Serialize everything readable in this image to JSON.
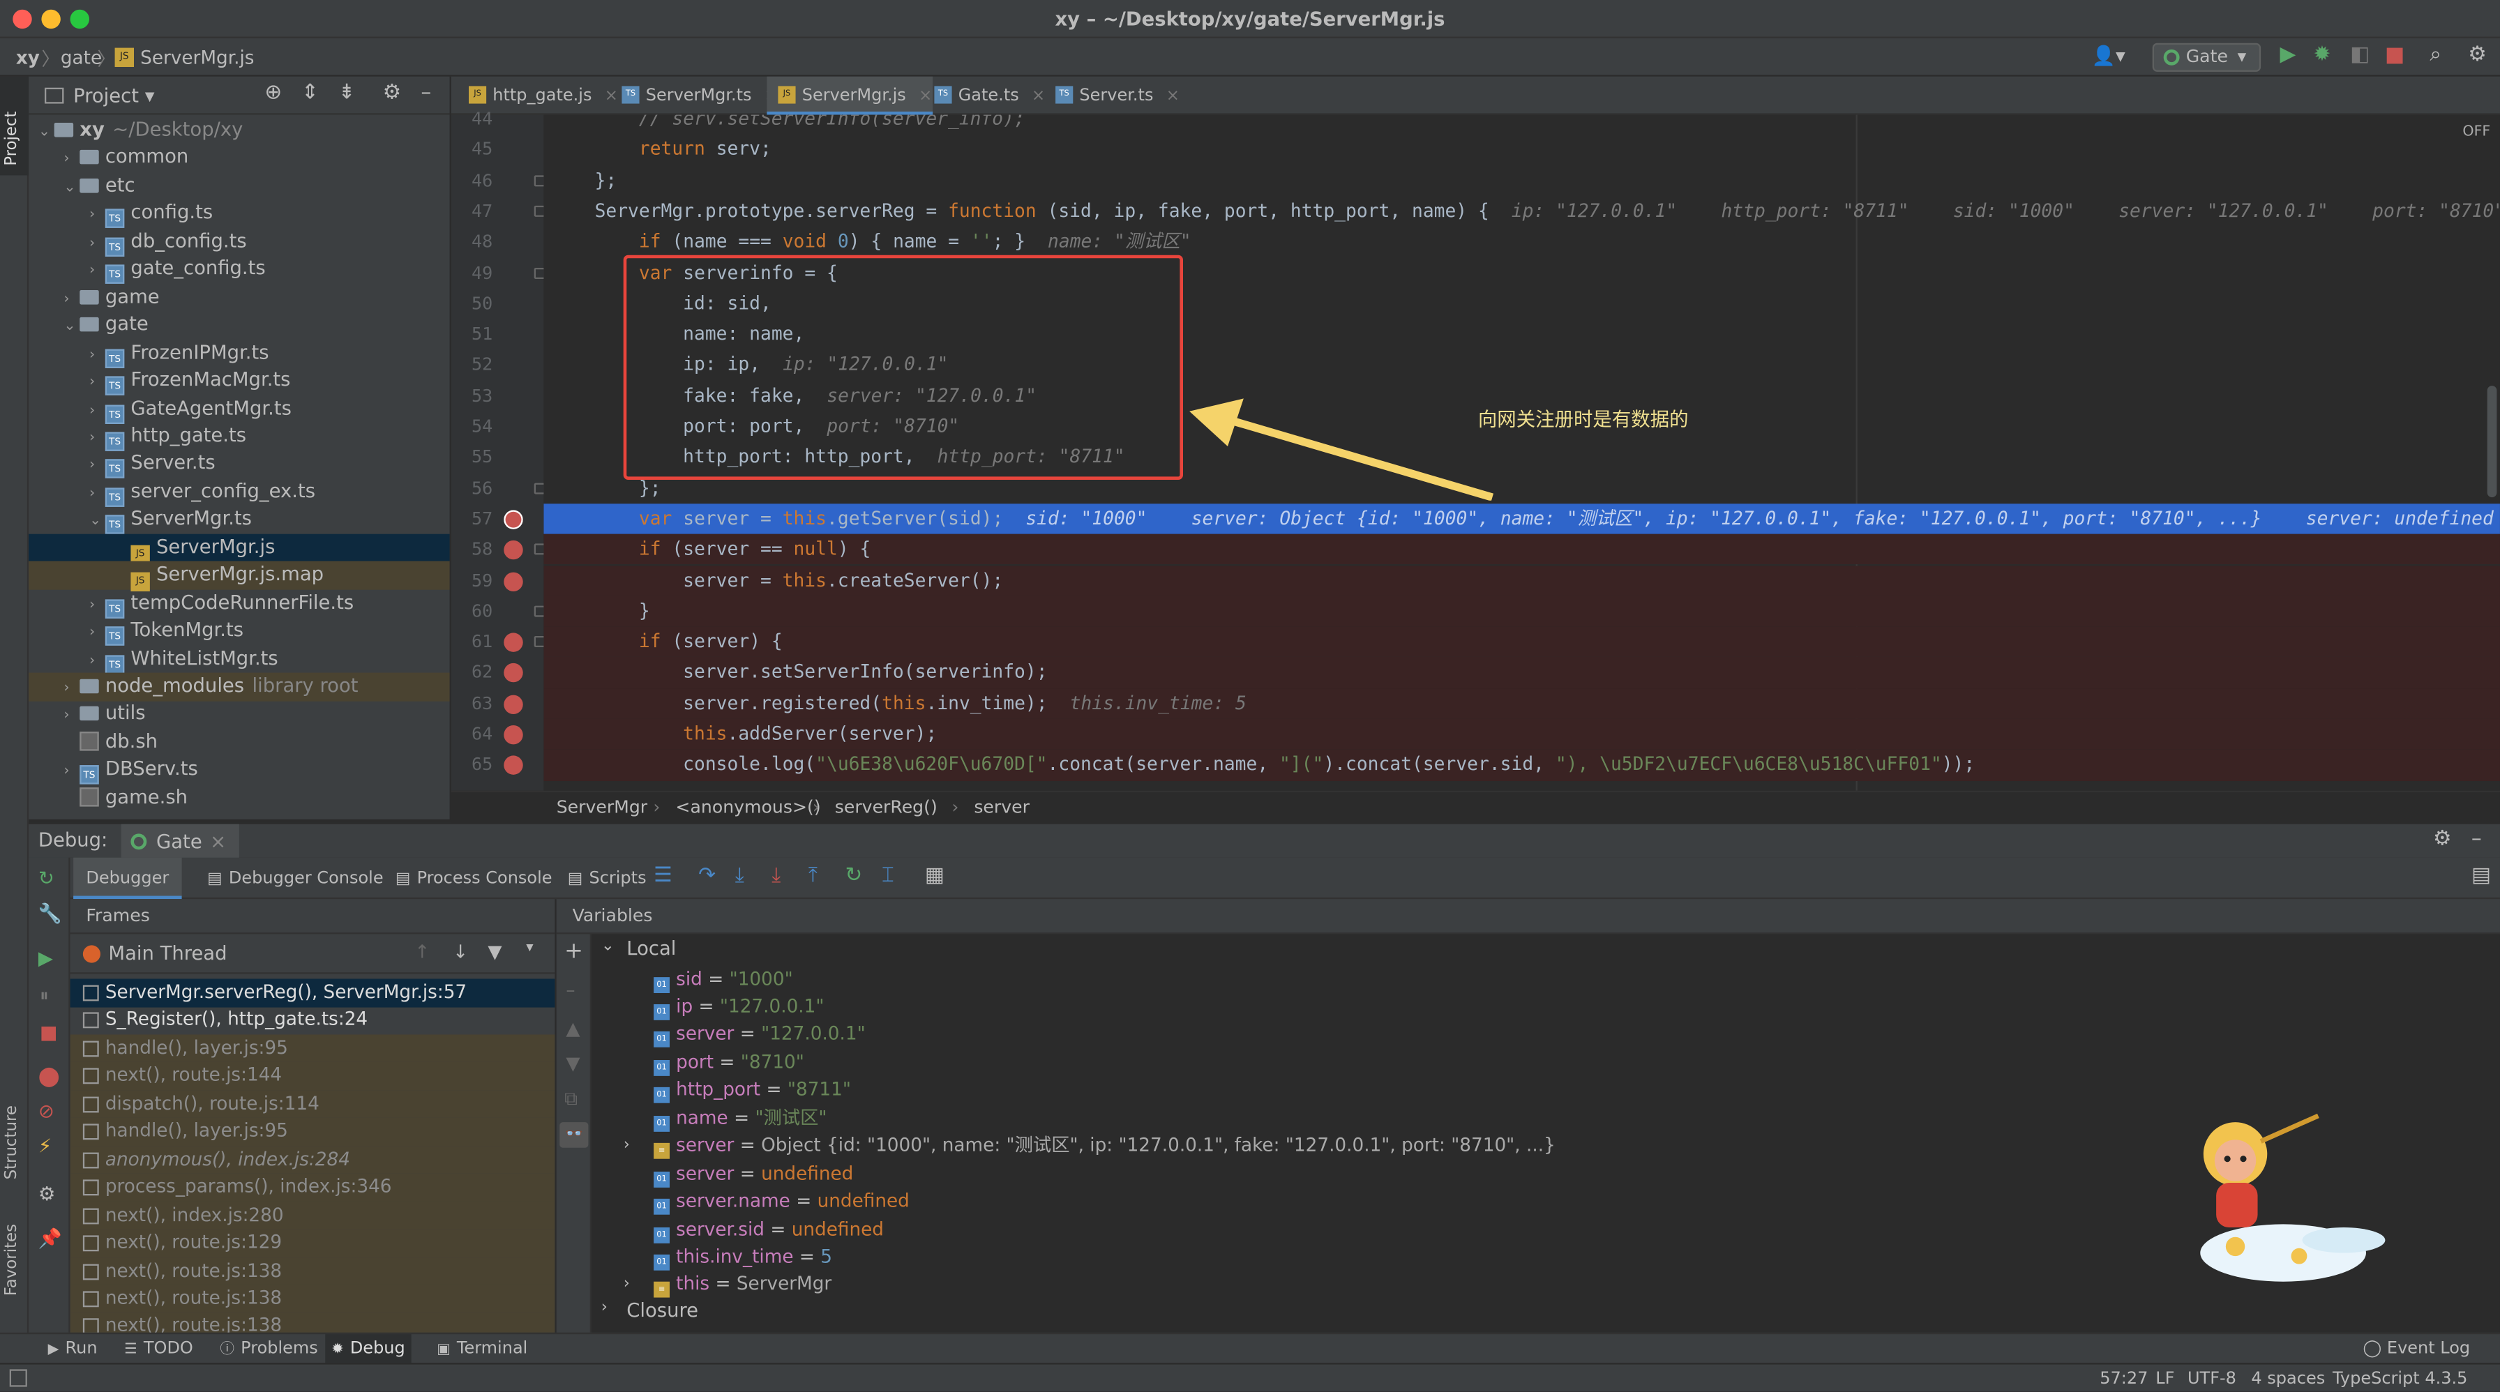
{
  "window": {
    "title": "xy – ~/Desktop/xy/gate/ServerMgr.js"
  },
  "navbar": {
    "crumbs": [
      "xy",
      "gate",
      "ServerMgr.js"
    ],
    "run_config": "Gate"
  },
  "sidebar": {
    "project_tab": "Project",
    "structure_tab": "Structure",
    "favorites_tab": "Favorites"
  },
  "project": {
    "header": "Project",
    "tree": [
      {
        "label": "xy",
        "suffix": "~/Desktop/xy",
        "kind": "folder",
        "depth": 0,
        "open": true
      },
      {
        "label": "common",
        "kind": "folder",
        "depth": 1,
        "open": false
      },
      {
        "label": "etc",
        "kind": "folder",
        "depth": 1,
        "open": true
      },
      {
        "label": "config.ts",
        "kind": "ts",
        "depth": 2,
        "open": false
      },
      {
        "label": "db_config.ts",
        "kind": "ts",
        "depth": 2,
        "open": false
      },
      {
        "label": "gate_config.ts",
        "kind": "ts",
        "depth": 2,
        "open": false
      },
      {
        "label": "game",
        "kind": "folder",
        "depth": 1,
        "open": false
      },
      {
        "label": "gate",
        "kind": "folder",
        "depth": 1,
        "open": true
      },
      {
        "label": "FrozenIPMgr.ts",
        "kind": "ts",
        "depth": 2,
        "open": false
      },
      {
        "label": "FrozenMacMgr.ts",
        "kind": "ts",
        "depth": 2,
        "open": false
      },
      {
        "label": "GateAgentMgr.ts",
        "kind": "ts",
        "depth": 2,
        "open": false
      },
      {
        "label": "http_gate.ts",
        "kind": "ts",
        "depth": 2,
        "open": false
      },
      {
        "label": "Server.ts",
        "kind": "ts",
        "depth": 2,
        "open": false
      },
      {
        "label": "server_config_ex.ts",
        "kind": "ts",
        "depth": 2,
        "open": false
      },
      {
        "label": "ServerMgr.ts",
        "kind": "ts",
        "depth": 2,
        "open": true
      },
      {
        "label": "ServerMgr.js",
        "kind": "js",
        "depth": 3,
        "selected": true
      },
      {
        "label": "ServerMgr.js.map",
        "kind": "js",
        "depth": 3
      },
      {
        "label": "tempCodeRunnerFile.ts",
        "kind": "ts",
        "depth": 2,
        "open": false
      },
      {
        "label": "TokenMgr.ts",
        "kind": "ts",
        "depth": 2,
        "open": false
      },
      {
        "label": "WhiteListMgr.ts",
        "kind": "ts",
        "depth": 2,
        "open": false
      },
      {
        "label": "node_modules",
        "suffix": "library root",
        "kind": "folder",
        "depth": 1,
        "open": false,
        "lib": true
      },
      {
        "label": "utils",
        "kind": "folder",
        "depth": 1,
        "open": false
      },
      {
        "label": "db.sh",
        "kind": "file",
        "depth": 1
      },
      {
        "label": "DBServ.ts",
        "kind": "ts",
        "depth": 1,
        "open": false
      },
      {
        "label": "game.sh",
        "kind": "file",
        "depth": 1
      }
    ]
  },
  "editor": {
    "tabs": [
      "http_gate.js",
      "ServerMgr.ts",
      "ServerMgr.js",
      "Gate.ts",
      "Server.ts"
    ],
    "active_tab": 2,
    "off_label": "OFF",
    "annotation": "向网关注册时是有数据的",
    "breadcrumb": [
      "ServerMgr",
      "<anonymous>()",
      "serverReg()",
      "server"
    ],
    "line_numbers": [
      "44",
      "45",
      "46",
      "47",
      "48",
      "49",
      "50",
      "51",
      "52",
      "53",
      "54",
      "55",
      "56",
      "57",
      "58",
      "59",
      "60",
      "61",
      "62",
      "63",
      "64",
      "65"
    ],
    "lines": [
      {
        "code": "    // serv.setServerInfo(server_info);",
        "hint": ""
      },
      {
        "code": "    return serv;",
        "hint": ""
      },
      {
        "code": "};",
        "hint": ""
      },
      {
        "code": "ServerMgr.prototype.serverReg = function (sid, ip, fake, port, http_port, name) {",
        "hint": "ip: \"127.0.0.1\"    http_port: \"8711\"    sid: \"1000\"    server: \"127.0.0.1\"    port: \"8710\""
      },
      {
        "code": "    if (name === void 0) { name = ''; }",
        "hint": "name: \"测试区\""
      },
      {
        "code": "    var serverinfo = {",
        "hint": ""
      },
      {
        "code": "        id: sid,",
        "hint": ""
      },
      {
        "code": "        name: name,",
        "hint": ""
      },
      {
        "code": "        ip: ip,",
        "hint": "ip: \"127.0.0.1\""
      },
      {
        "code": "        fake: fake,",
        "hint": "server: \"127.0.0.1\""
      },
      {
        "code": "        port: port,",
        "hint": "port: \"8710\""
      },
      {
        "code": "        http_port: http_port,",
        "hint": "http_port: \"8711\""
      },
      {
        "code": "    };",
        "hint": ""
      },
      {
        "code": "    var server = this.getServer(sid);",
        "hint": "sid: \"1000\"    server: Object {id: \"1000\", name: \"测试区\", ip: \"127.0.0.1\", fake: \"127.0.0.1\", port: \"8710\", ...}    server: undefined"
      },
      {
        "code": "    if (server == null) {",
        "hint": ""
      },
      {
        "code": "        server = this.createServer();",
        "hint": ""
      },
      {
        "code": "    }",
        "hint": ""
      },
      {
        "code": "    if (server) {",
        "hint": ""
      },
      {
        "code": "        server.setServerInfo(serverinfo);",
        "hint": ""
      },
      {
        "code": "        server.registered(this.inv_time);",
        "hint": "this.inv_time: 5"
      },
      {
        "code": "        this.addServer(server);",
        "hint": ""
      },
      {
        "code": "        console.log(\"\\u6E38\\u620F\\u670D[\".concat(server.name, \"](\").concat(server.sid, \"), \\u5DF2\\u7ECF\\u6CE8\\u518C\\uFF01\"));",
        "hint": ""
      }
    ]
  },
  "debug": {
    "title": "Debug:",
    "config_tab": "Gate",
    "tabs": [
      "Debugger",
      "Debugger Console",
      "Process Console",
      "Scripts"
    ],
    "frames_label": "Frames",
    "variables_label": "Variables",
    "thread": "Main Thread",
    "frames": [
      "ServerMgr.serverReg(), ServerMgr.js:57",
      "S_Register(), http_gate.ts:24",
      "handle(), layer.js:95",
      "next(), route.js:144",
      "dispatch(), route.js:114",
      "handle(), layer.js:95",
      "anonymous(), index.js:284",
      "process_params(), index.js:346",
      "next(), index.js:280",
      "next(), route.js:129",
      "next(), route.js:138",
      "next(), route.js:138",
      "next(), route.js:138"
    ],
    "scopes": {
      "local": "Local",
      "closure": "Closure"
    },
    "variables": [
      {
        "name": "sid",
        "value": "\"1000\"",
        "type": "str"
      },
      {
        "name": "ip",
        "value": "\"127.0.0.1\"",
        "type": "str"
      },
      {
        "name": "server",
        "value": "\"127.0.0.1\"",
        "type": "str"
      },
      {
        "name": "port",
        "value": "\"8710\"",
        "type": "str"
      },
      {
        "name": "http_port",
        "value": "\"8711\"",
        "type": "str"
      },
      {
        "name": "name",
        "value": "\"测试区\"",
        "type": "str"
      },
      {
        "name": "server",
        "value": "Object {id: \"1000\", name: \"测试区\", ip: \"127.0.0.1\", fake: \"127.0.0.1\", port: \"8710\", ...}",
        "type": "obj"
      },
      {
        "name": "server",
        "value": "undefined",
        "type": "und"
      },
      {
        "name": "server.name",
        "value": "undefined",
        "type": "und"
      },
      {
        "name": "server.sid",
        "value": "undefined",
        "type": "und"
      },
      {
        "name": "this.inv_time",
        "value": "5",
        "type": "num"
      },
      {
        "name": "this",
        "value": "ServerMgr",
        "type": "obj"
      }
    ]
  },
  "bottom_tabs": [
    "Run",
    "TODO",
    "Problems",
    "Debug",
    "Terminal"
  ],
  "event_log": "Event Log",
  "status": {
    "position": "57:27",
    "line_sep": "LF",
    "encoding": "UTF-8",
    "indent": "4 spaces",
    "lang": "TypeScript 4.3.5"
  },
  "colors": {
    "accent_blue": "#2f65ca",
    "breakpoint_red": "#c75450",
    "annotation_yellow": "#f5d36a",
    "box_red": "#e8453c"
  }
}
